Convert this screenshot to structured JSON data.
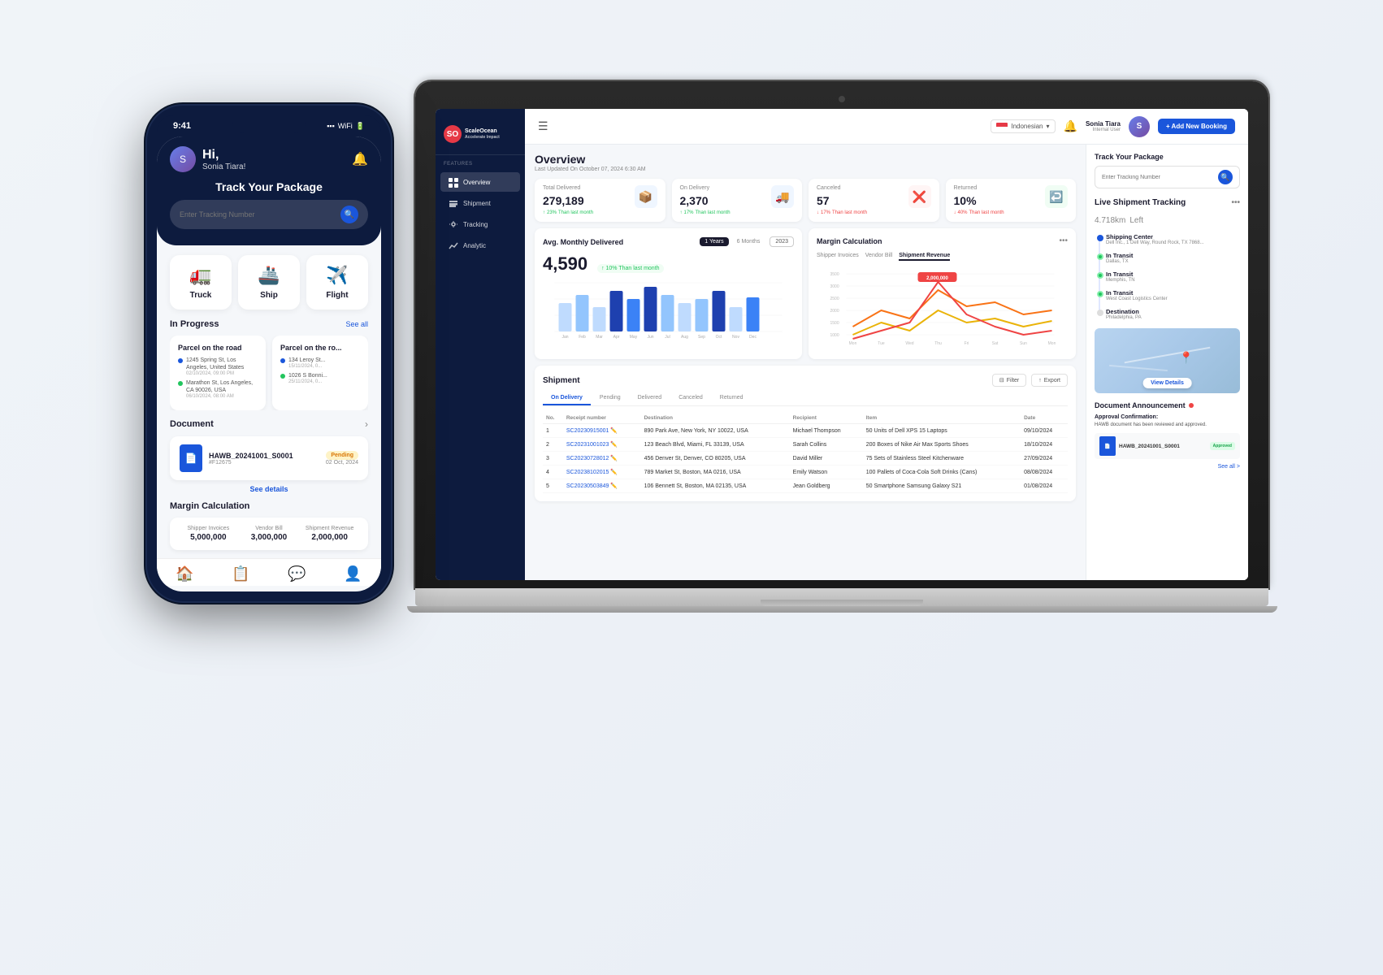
{
  "app": {
    "name": "ScaleOcean",
    "tagline": "Accelerate Impact"
  },
  "laptop": {
    "topbar": {
      "menu_icon": "☰",
      "lang": "Indonesian",
      "bell_icon": "🔔",
      "add_button": "+ Add New Booking",
      "user": {
        "name": "Sonia Tiara",
        "role": "Internal User"
      }
    },
    "sidebar": {
      "features_label": "FEATURES",
      "nav_items": [
        {
          "label": "Overview",
          "active": true
        },
        {
          "label": "Shipment",
          "active": false
        },
        {
          "label": "Tracking",
          "active": false
        },
        {
          "label": "Analytic",
          "active": false
        }
      ]
    },
    "overview": {
      "title": "Overview",
      "subtitle": "Last Updated On October 07, 2024 6:30 AM",
      "stats": [
        {
          "label": "Total Delivered",
          "value": "279,189",
          "change": "23%",
          "direction": "up",
          "change_text": "Than last month"
        },
        {
          "label": "On Delivery",
          "value": "2,370",
          "change": "17%",
          "direction": "up",
          "change_text": "Than last month"
        },
        {
          "label": "Canceled",
          "value": "57",
          "change": "17%",
          "direction": "down",
          "change_text": "Than last month"
        },
        {
          "label": "Returned",
          "value": "10%",
          "change": "40%",
          "direction": "down",
          "change_text": "Than last month"
        }
      ]
    },
    "avg_chart": {
      "title": "Avg. Monthly Delivered",
      "year": "2023",
      "tabs": [
        "1 Years",
        "6 Months"
      ],
      "big_number": "4,590",
      "change": "10% Than last month",
      "months": [
        "Jan",
        "Feb",
        "Mar",
        "Apr",
        "May",
        "Jun",
        "Jul",
        "Aug",
        "Sep",
        "Oct",
        "Nov",
        "Dec"
      ]
    },
    "margin_chart": {
      "title": "Margin Calculation",
      "tabs": [
        "Shipper Invoices",
        "Vendor Bill",
        "Shipment Revenue"
      ],
      "active_tab": "Shipment Revenue",
      "peak_label": "2,000,000",
      "x_labels": [
        "Mon",
        "Tue",
        "Wed",
        "Thu",
        "Fri",
        "Sat",
        "Sun",
        "Mon"
      ]
    },
    "shipment": {
      "title": "Shipment",
      "filter_btn": "Filter",
      "export_btn": "Export",
      "tabs": [
        "On Delivery",
        "Pending",
        "Delivered",
        "Canceled",
        "Returned"
      ],
      "active_tab": "On Delivery",
      "columns": [
        "No.",
        "Receipt number",
        "Destination",
        "Recipient",
        "Item",
        "Date"
      ],
      "rows": [
        {
          "no": "1",
          "receipt": "SC20230915001",
          "destination": "890 Park Ave, New York, NY 10022, USA",
          "recipient": "Michael Thompson",
          "item": "50 Units of Dell XPS 15 Laptops",
          "date": "09/10/2024"
        },
        {
          "no": "2",
          "receipt": "SC20231001023",
          "destination": "123 Beach Blvd, Miami, FL 33139, USA",
          "recipient": "Sarah Collins",
          "item": "200 Boxes of Nike Air Max Sports Shoes",
          "date": "18/10/2024"
        },
        {
          "no": "3",
          "receipt": "SC20230728012",
          "destination": "456 Denver St, Denver, CO 80205, USA",
          "recipient": "David Miller",
          "item": "75 Sets of Stainless Steel Kitchenware",
          "date": "27/09/2024"
        },
        {
          "no": "4",
          "receipt": "SC20238102015",
          "destination": "789 Market St, Boston, MA 0216, USA",
          "recipient": "Emily Watson",
          "item": "100 Pallets of Coca-Cola Soft Drinks (Cans)",
          "date": "08/08/2024"
        },
        {
          "no": "5",
          "receipt": "SC20230503849",
          "destination": "106 Bennett St, Boston, MA 02135, USA",
          "recipient": "Jean Goldberg",
          "item": "50 Smartphone Samsung Galaxy S21",
          "date": "01/08/2024"
        }
      ]
    }
  },
  "right_panel": {
    "track_package_title": "Track Your Package",
    "search_placeholder": "Enter Tracking Number",
    "live_tracking_title": "Live Shipment Tracking",
    "distance": "4.718km",
    "distance_unit": "Left",
    "steps": [
      {
        "status": "completed",
        "title": "Shipping Center",
        "sub": "Dell Inc., 1 Dell Way, Round Rock, TX 7868..."
      },
      {
        "status": "in-transit",
        "title": "In Transit",
        "sub": "Dallas, TX"
      },
      {
        "status": "in-transit",
        "title": "In Transit",
        "sub": "Memphis, TN"
      },
      {
        "status": "in-transit",
        "title": "In Transit",
        "sub": "West Coast Logistics Center"
      },
      {
        "status": "destination",
        "title": "Destination",
        "sub": "Philadelphia, PA"
      }
    ],
    "view_details": "View Details",
    "doc_title": "Document Announcement",
    "doc_approval_title": "Approval Confirmation:",
    "doc_approval_text": "HAWB document has been reviewed and approved.",
    "doc_file_name": "HAWB_20241001_S0001",
    "doc_approved_label": "Approved",
    "see_all": "See all >"
  },
  "mobile": {
    "time": "9:41",
    "greeting_hi": "Hi,",
    "greeting_name": "Sonia Tiara!",
    "track_title": "Track Your Package",
    "search_placeholder": "Enter Tracking Number",
    "transport_options": [
      {
        "label": "Truck",
        "icon": "🚛"
      },
      {
        "label": "Ship",
        "icon": "🚢"
      },
      {
        "label": "Flight",
        "icon": "✈️"
      }
    ],
    "in_progress_title": "In Progress",
    "see_all": "See all",
    "progress_cards": [
      {
        "title": "Parcel on the road",
        "from_address": "1245 Spring St, Los Angeles, United States",
        "from_date": "02/10/2024, 09:00 PM",
        "to_address": "Marathon St, Los Angeles, CA 90026, USA",
        "to_date": "06/10/2024, 08:00 AM"
      },
      {
        "title": "Parcel on the ro...",
        "from_address": "134 Leroy St...",
        "from_date": "15/11/2024, 0...",
        "to_address": "1026 S Bonni...",
        "to_date": "25/11/2024, 0..."
      }
    ],
    "document_title": "Document",
    "doc_name": "HAWB_20241001_S0001",
    "doc_id": "#F12675",
    "doc_status": "Pending",
    "doc_date": "02 Oct, 2024",
    "see_details": "See details",
    "margin_title": "Margin Calculation",
    "margin_items": [
      {
        "label": "Shipper Invoices",
        "value": "5,000,000"
      },
      {
        "label": "Vendor Bill",
        "value": "3,000,000"
      },
      {
        "label": "Shipment Revenue",
        "value": "2,000,000"
      }
    ],
    "bottom_nav": [
      {
        "icon": "🏠",
        "active": true
      },
      {
        "icon": "📋",
        "active": false
      },
      {
        "icon": "💬",
        "active": false
      },
      {
        "icon": "👤",
        "active": false
      }
    ]
  }
}
